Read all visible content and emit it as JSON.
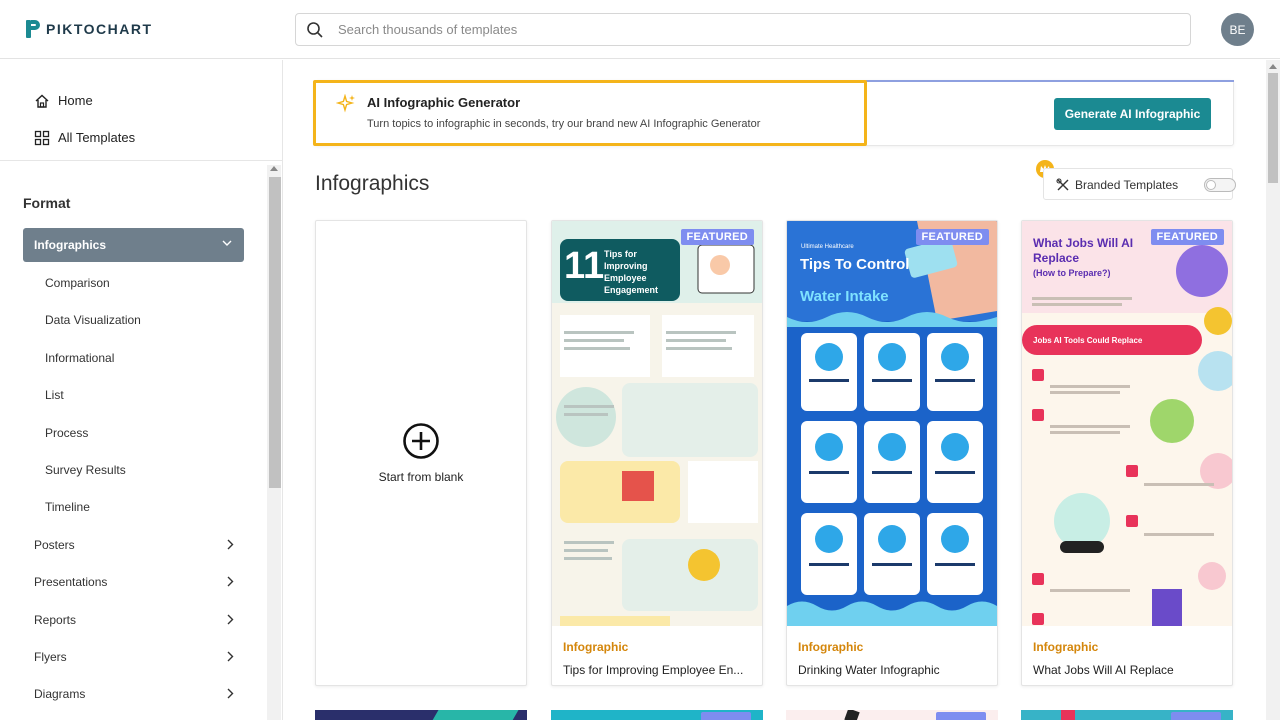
{
  "header": {
    "logo_text": "PIKTOCHART",
    "search_placeholder": "Search thousands of templates",
    "avatar_initials": "BE"
  },
  "sidebar": {
    "nav": [
      {
        "label": "Home",
        "icon": "home-icon"
      },
      {
        "label": "All Templates",
        "icon": "grid-icon"
      }
    ],
    "format_title": "Format",
    "active_format": "Infographics",
    "subitems": [
      "Comparison",
      "Data Visualization",
      "Informational",
      "List",
      "Process",
      "Survey Results",
      "Timeline"
    ],
    "categories": [
      "Posters",
      "Presentations",
      "Reports",
      "Flyers",
      "Diagrams"
    ]
  },
  "banner": {
    "title": "AI Infographic Generator",
    "description": "Turn topics to infographic in seconds, try our brand new AI Infographic Generator",
    "button_label": "Generate AI Infographic"
  },
  "section": {
    "title": "Infographics",
    "branded_label": "Branded Templates",
    "branded_enabled": false
  },
  "cards": [
    {
      "blank": true,
      "label": "Start from blank"
    },
    {
      "badge": "FEATURED",
      "category": "Infographic",
      "name": "Tips for Improving Employee En...",
      "thumb_title": "11",
      "thumb_subtitle": "Tips for Improving Employee Engagement"
    },
    {
      "badge": "FEATURED",
      "category": "Infographic",
      "name": "Drinking Water Infographic",
      "thumb_kicker": "Ultimate Healthcare",
      "thumb_title": "Tips To Control",
      "thumb_title2": "Water Intake"
    },
    {
      "badge": "FEATURED",
      "category": "Infographic",
      "name": "What Jobs Will AI Replace",
      "thumb_title": "What Jobs Will AI Replace",
      "thumb_subtitle": "(How to Prepare?)",
      "thumb_band": "Jobs AI Tools Could Replace"
    }
  ],
  "colors": {
    "accent_teal": "#1b8a92",
    "highlight": "#f4b41a",
    "active_item": "#6f7f8c",
    "badge": "#7e8df0",
    "category": "#d4860b"
  }
}
